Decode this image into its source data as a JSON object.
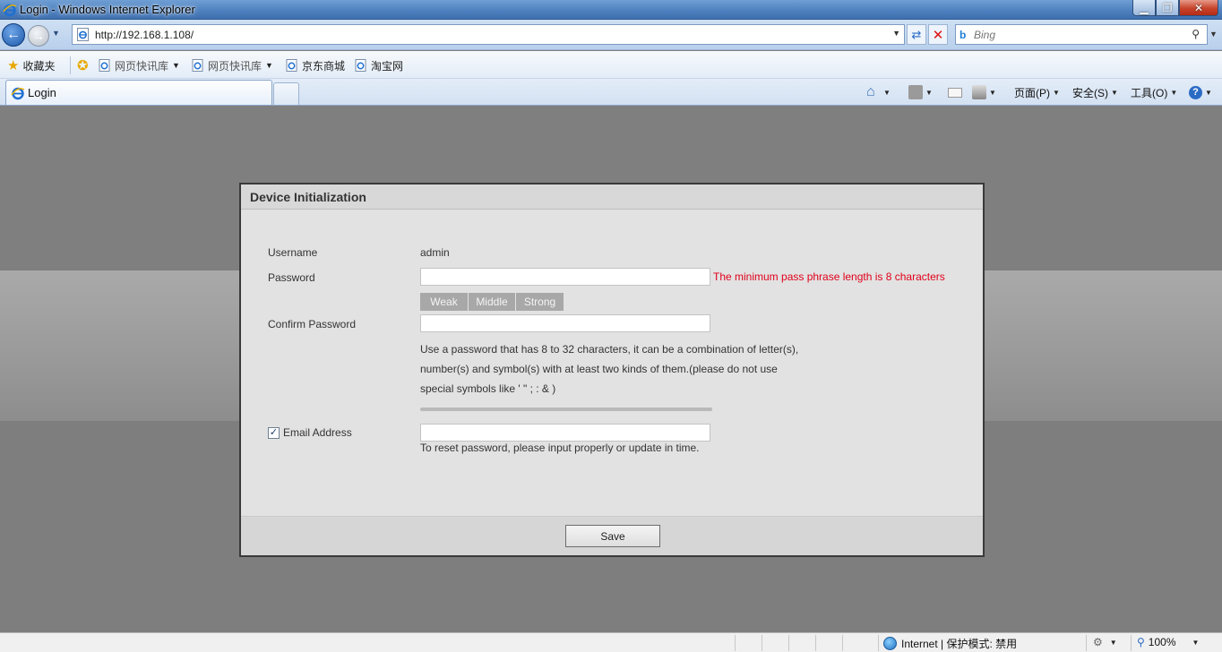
{
  "window": {
    "title": "Login - Windows Internet Explorer",
    "minimize": "▁",
    "restore": "❐",
    "close": "✕"
  },
  "navigation": {
    "url": "http://192.168.1.108/",
    "search_placeholder": "Bing"
  },
  "favorites": {
    "favorites_label": "收藏夹",
    "items": [
      "网页快讯库",
      "网页快讯库",
      "京东商城",
      "淘宝网"
    ]
  },
  "tabs": {
    "active_label": "Login"
  },
  "command_bar": {
    "page_label": "页面(P)",
    "safety_label": "安全(S)",
    "tools_label": "工具(O)",
    "help_label": "?"
  },
  "dialog": {
    "title": "Device Initialization",
    "username_label": "Username",
    "username_value": "admin",
    "password_label": "Password",
    "password_error": "The minimum pass phrase length is 8 characters",
    "strength": [
      "Weak",
      "Middle",
      "Strong"
    ],
    "confirm_label": "Confirm Password",
    "hint_lines": [
      "Use a password that has 8 to 32 characters, it can be a combination of letter(s),",
      "number(s) and symbol(s) with at least two kinds of them.(please do not use",
      "special symbols like ' \" ; : & )"
    ],
    "email_label": "Email Address",
    "email_checked": true,
    "email_hint": "To reset password, please input properly or update in time.",
    "save_label": "Save"
  },
  "status_bar": {
    "zone_text": "Internet | 保护模式: 禁用",
    "zoom": "100%"
  },
  "colors": {
    "error": "#e0001a",
    "strength_bg": "#a8a8a8",
    "dialog_bg": "#e2e2e2",
    "page_bg": "#7f7f7f"
  }
}
